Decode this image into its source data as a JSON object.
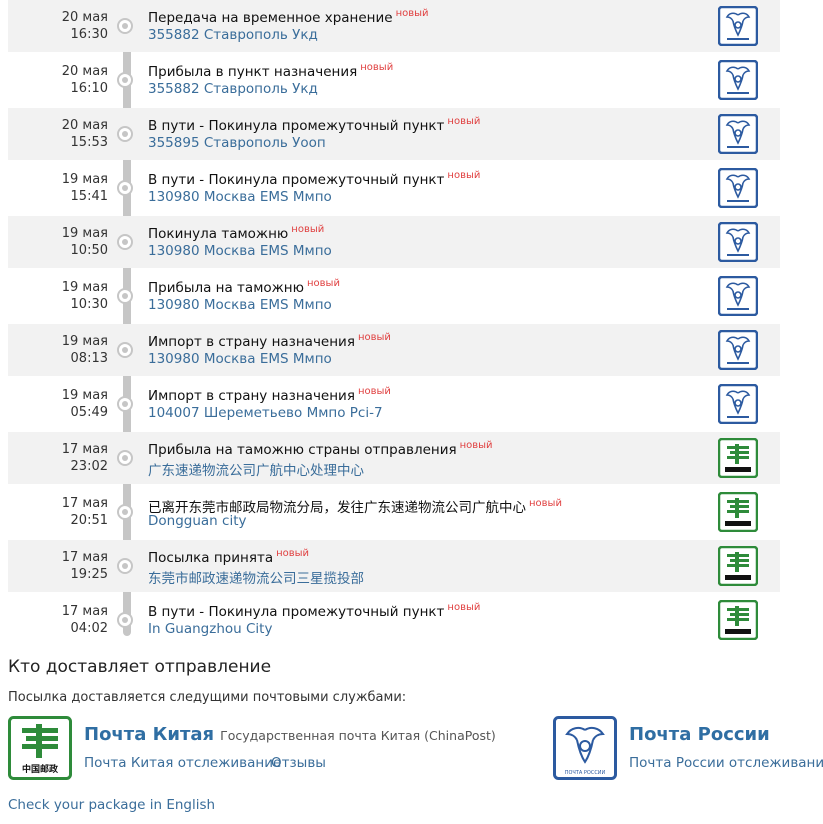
{
  "new_badge": "новый",
  "colors": {
    "russian_post": "#2c5aa0",
    "china_post": "#2e8b3a",
    "new_badge": "#e04040",
    "link": "#3a6d9a"
  },
  "events": [
    {
      "date": "20 мая",
      "time": "16:30",
      "status": "Передача на временное хранение",
      "location": "355882 Ставрополь Укд",
      "carrier": "russian-post"
    },
    {
      "date": "20 мая",
      "time": "16:10",
      "status": "Прибыла в пункт назначения",
      "location": "355882 Ставрополь Укд",
      "carrier": "russian-post"
    },
    {
      "date": "20 мая",
      "time": "15:53",
      "status": "В пути - Покинула промежуточный пункт",
      "location": "355895 Ставрополь Уооп",
      "carrier": "russian-post"
    },
    {
      "date": "19 мая",
      "time": "15:41",
      "status": "В пути - Покинула промежуточный пункт",
      "location": "130980 Москва EMS Ммпо",
      "carrier": "russian-post"
    },
    {
      "date": "19 мая",
      "time": "10:50",
      "status": "Покинула таможню",
      "location": "130980 Москва EMS Ммпо",
      "carrier": "russian-post"
    },
    {
      "date": "19 мая",
      "time": "10:30",
      "status": "Прибыла на таможню",
      "location": "130980 Москва EMS Ммпо",
      "carrier": "russian-post"
    },
    {
      "date": "19 мая",
      "time": "08:13",
      "status": "Импорт в страну назначения",
      "location": "130980 Москва EMS Ммпо",
      "carrier": "russian-post"
    },
    {
      "date": "19 мая",
      "time": "05:49",
      "status": "Импорт в страну назначения",
      "location": "104007 Шереметьево Ммпо Pci-7",
      "carrier": "russian-post"
    },
    {
      "date": "17 мая",
      "time": "23:02",
      "status": "Прибыла на таможню страны отправления",
      "location": "广东速递物流公司广航中心处理中心",
      "carrier": "china-post"
    },
    {
      "date": "17 мая",
      "time": "20:51",
      "status": "已离开东莞市邮政局物流分局，发往广东速递物流公司广航中心",
      "location": "Dongguan city",
      "carrier": "china-post"
    },
    {
      "date": "17 мая",
      "time": "19:25",
      "status": "Посылка принята",
      "location": "东莞市邮政速递物流公司三星揽投部",
      "carrier": "china-post"
    },
    {
      "date": "17 мая",
      "time": "04:02",
      "status": "В пути - Покинула промежуточный пункт",
      "location": "In Guangzhou City",
      "carrier": "china-post"
    }
  ],
  "delivery": {
    "title": "Кто доставляет отправление",
    "description": "Посылка доставляется следущими почтовыми службами:",
    "china_post": {
      "name": "Почта Китая",
      "subtitle": "Государственная почта Китая (ChinaPost)",
      "tracking_link": "Почта Китая отслеживание",
      "reviews_link": "Отзывы",
      "logo_text": "中国邮政"
    },
    "russian_post": {
      "name": "Почта России",
      "tracking_link": "Почта России отслеживание",
      "logo_text": "ПОЧТА РОССИИ"
    }
  },
  "footer": {
    "english_link": "Check your package in English"
  }
}
